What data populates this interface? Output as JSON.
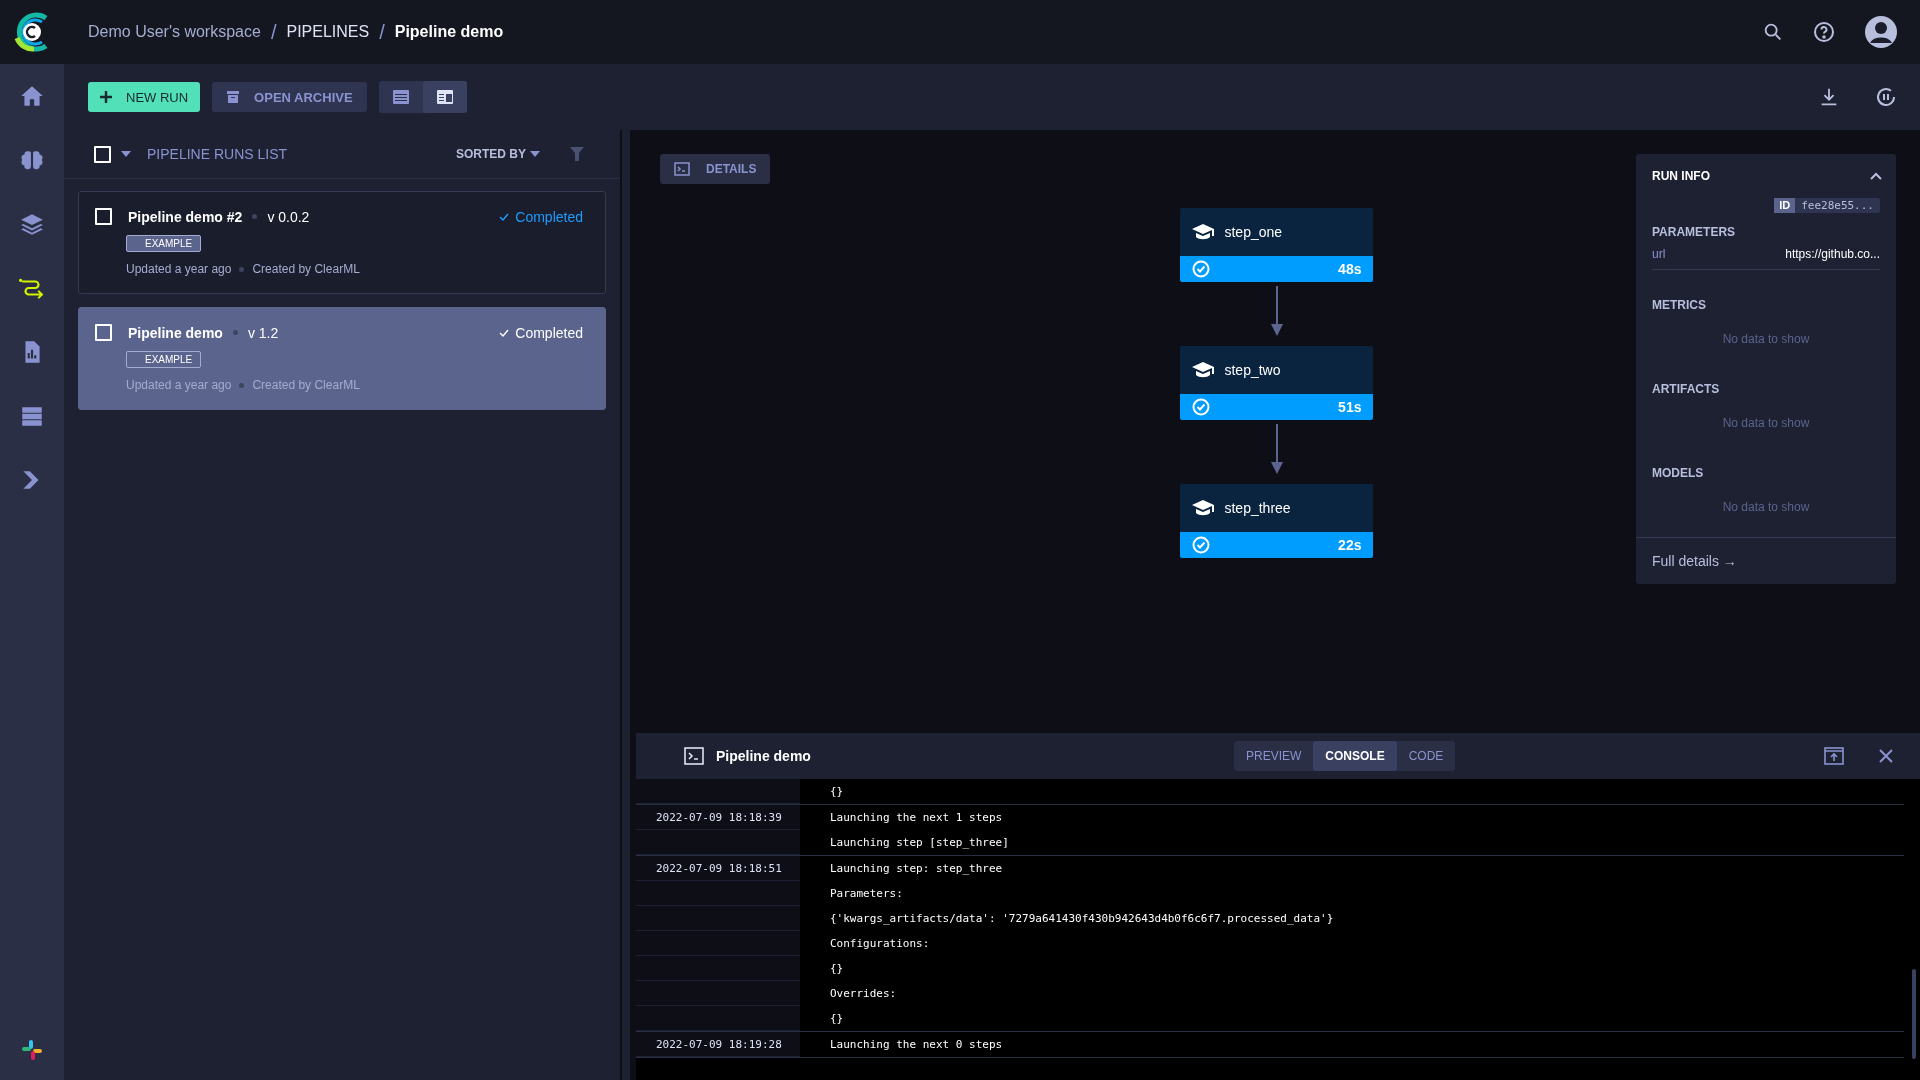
{
  "breadcrumb": [
    {
      "label": "Demo User's workspace",
      "kind": "link"
    },
    {
      "label": "PIPELINES",
      "kind": "link",
      "separator": "/"
    },
    {
      "label": "Pipeline demo",
      "kind": "current",
      "separator": "/"
    }
  ],
  "sidebar": {
    "items": [
      {
        "kind": "home",
        "selected": false
      },
      {
        "kind": "brain",
        "selected": false
      },
      {
        "kind": "layers",
        "selected": false
      },
      {
        "kind": "pipelines",
        "selected": true
      },
      {
        "kind": "report",
        "selected": false
      },
      {
        "kind": "datastore",
        "selected": false
      },
      {
        "kind": "deploy",
        "selected": false
      }
    ]
  },
  "toolbar": {
    "new_run": "NEW RUN",
    "open_archive": "OPEN ARCHIVE",
    "view_modes": [
      {
        "kind": "table",
        "selected": false
      },
      {
        "kind": "details",
        "selected": true
      }
    ]
  },
  "runs_list": {
    "title": "PIPELINE RUNS LIST",
    "sorted_by": "SORTED BY",
    "select_all_checked": false,
    "runs": [
      {
        "name": "Pipeline demo #2",
        "version": "v 0.0.2",
        "status": "Completed",
        "tag": "EXAMPLE",
        "updated": "Updated a year ago",
        "created_by": "Created by ClearML",
        "checked": false,
        "selected": false
      },
      {
        "name": "Pipeline demo",
        "version": "v 1.2",
        "status": "Completed",
        "tag": "EXAMPLE",
        "updated": "Updated a year ago",
        "created_by": "Created by ClearML",
        "checked": false,
        "selected": true
      }
    ]
  },
  "details_button": "DETAILS",
  "pipeline_steps": [
    {
      "name": "step_one",
      "duration": "48s"
    },
    {
      "name": "step_two",
      "duration": "51s"
    },
    {
      "name": "step_three",
      "duration": "22s"
    }
  ],
  "run_info": {
    "title": "RUN INFO",
    "id_label": "ID",
    "id": "fee28e55...",
    "parameters_title": "PARAMETERS",
    "parameters": [
      {
        "key": "url",
        "value": "https://github.co..."
      }
    ],
    "sections": [
      {
        "title": "METRICS",
        "empty": "No data to show"
      },
      {
        "title": "ARTIFACTS",
        "empty": "No data to show"
      },
      {
        "title": "MODELS",
        "empty": "No data to show"
      }
    ],
    "full_details": "Full details →"
  },
  "console": {
    "title": "Pipeline demo",
    "tabs": [
      {
        "label": "PREVIEW",
        "selected": false
      },
      {
        "label": "CONSOLE",
        "selected": true
      },
      {
        "label": "CODE",
        "selected": false
      }
    ],
    "entries": [
      {
        "lines": [
          "{}"
        ]
      },
      {
        "time": "2022-07-09 18:18:39",
        "lines": [
          "Launching the next 1 steps",
          "Launching step [step_three]"
        ]
      },
      {
        "time": "2022-07-09 18:18:51",
        "lines": [
          "Launching step: step_three",
          "Parameters:",
          "{'kwargs_artifacts/data': '7279a641430f430b942643d4b0f6c6f7.processed_data'}",
          "Configurations:",
          "{}",
          "Overrides:",
          "{}"
        ]
      },
      {
        "time": "2022-07-09 18:19:28",
        "lines": [
          "Launching the next 0 steps"
        ]
      }
    ]
  }
}
